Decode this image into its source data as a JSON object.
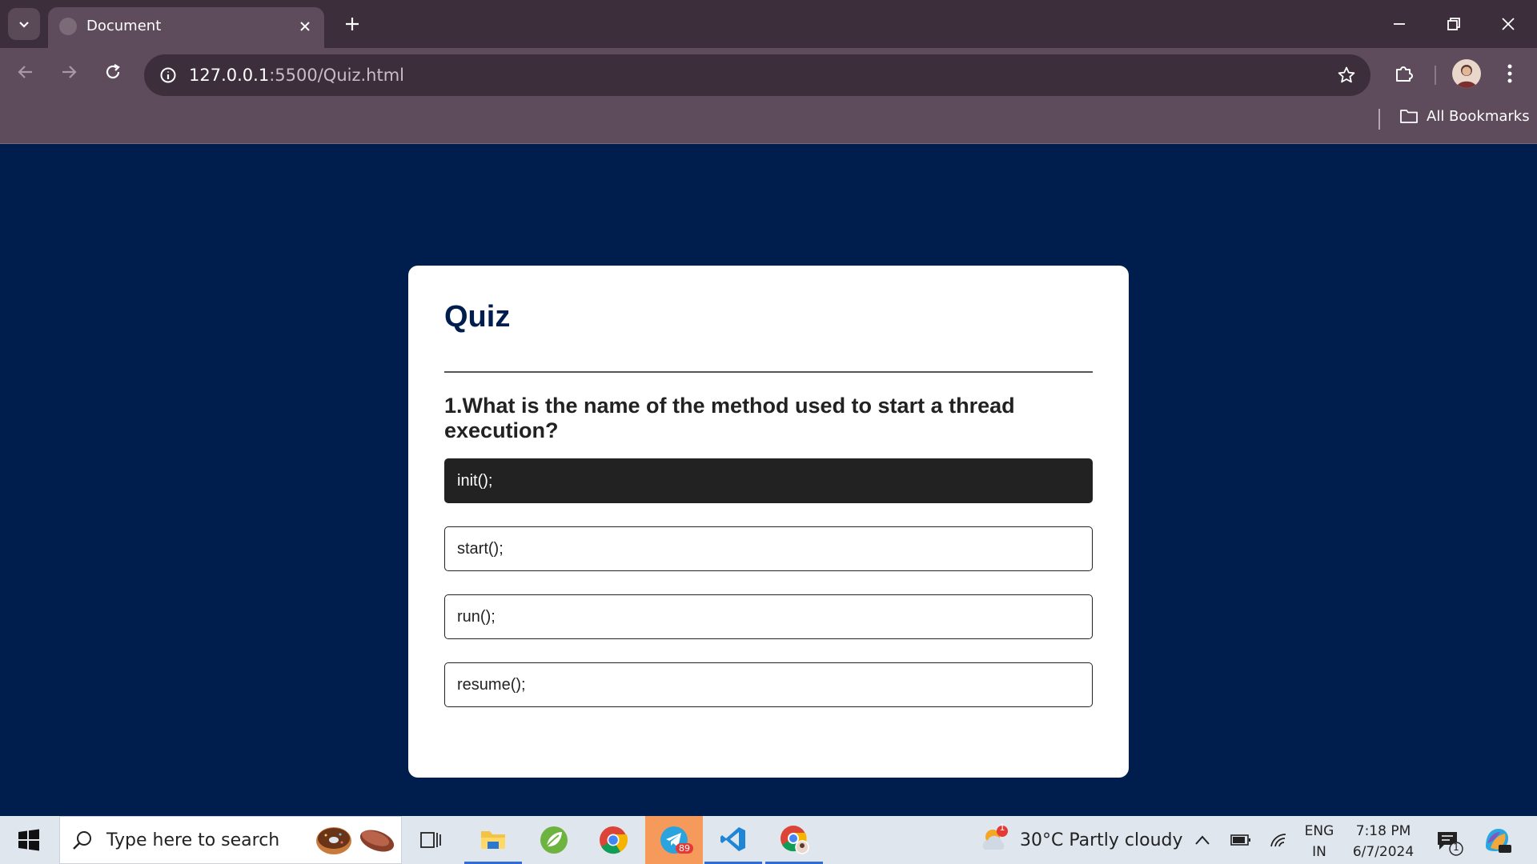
{
  "browser": {
    "tab_title": "Document",
    "url_host": "127.0.0.1",
    "url_path": ":5500/Quiz.html",
    "bookmarks_label": "All Bookmarks"
  },
  "quiz": {
    "title": "Quiz",
    "question": "1.What is the name of the method used to start a thread execution?",
    "answers": [
      {
        "label": "init();",
        "selected": true
      },
      {
        "label": "start();",
        "selected": false
      },
      {
        "label": "run();",
        "selected": false
      },
      {
        "label": "resume();",
        "selected": false
      }
    ]
  },
  "taskbar": {
    "search_placeholder": "Type here to search",
    "weather": "30°C  Partly cloudy",
    "weather_badge": "1",
    "telegram_badge": "89",
    "language": "ENG",
    "region": "IN",
    "time": "7:18 PM",
    "date": "6/7/2024",
    "notification_count": "1"
  },
  "colors": {
    "page_bg": "#001e4d",
    "card_bg": "#ffffff",
    "title_color": "#001e4d",
    "selected_answer_bg": "#222222"
  }
}
